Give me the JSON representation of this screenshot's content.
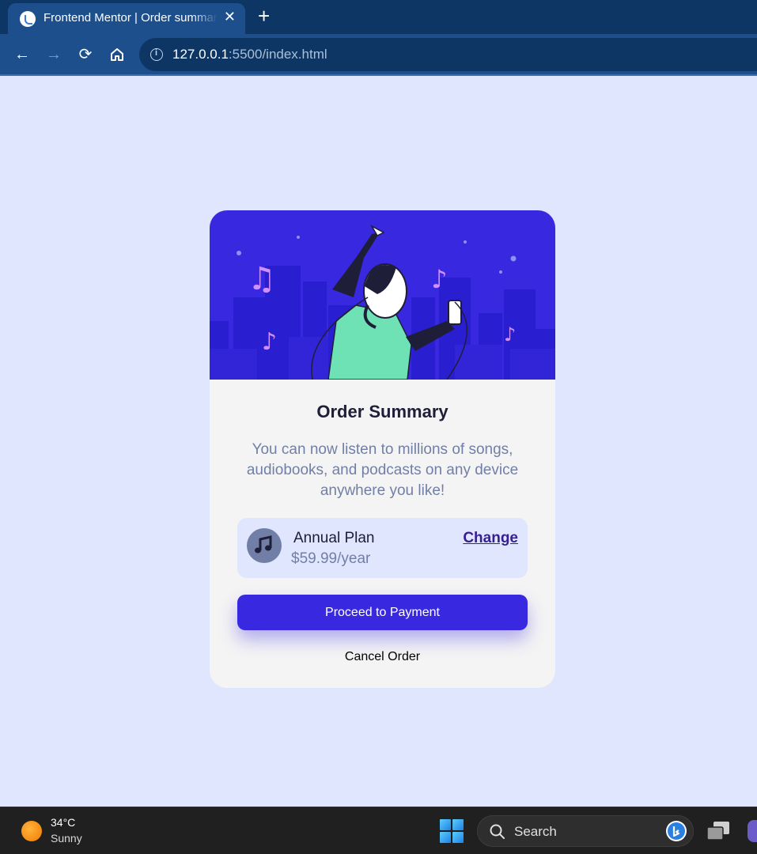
{
  "browser": {
    "tab_title": "Frontend Mentor | Order summary",
    "close_glyph": "✕",
    "new_tab_glyph": "+",
    "back_glyph": "←",
    "forward_glyph": "→",
    "reload_glyph": "⟳",
    "url_host": "127.0.0.1",
    "url_rest": ":5500/index.html"
  },
  "card": {
    "title": "Order Summary",
    "description": "You can now listen to millions of songs, audiobooks, and podcasts on any device anywhere you like!",
    "plan_name": "Annual Plan",
    "plan_price": "$59.99/year",
    "change_label": "Change",
    "pay_label": "Proceed to Payment",
    "cancel_label": "Cancel Order"
  },
  "taskbar": {
    "temperature": "34°C",
    "condition": "Sunny",
    "search_label": "Search"
  },
  "colors": {
    "page_bg": "#e0e6fd",
    "accent": "#3829e0",
    "hero_figure": "#6ee2b4",
    "note_color": "#d38fff"
  },
  "icons": [
    "back-icon",
    "forward-icon",
    "reload-icon",
    "home-icon",
    "info-icon",
    "music-icon",
    "windows-start-icon",
    "search-icon",
    "bing-icon",
    "task-view-icon",
    "teams-icon"
  ]
}
